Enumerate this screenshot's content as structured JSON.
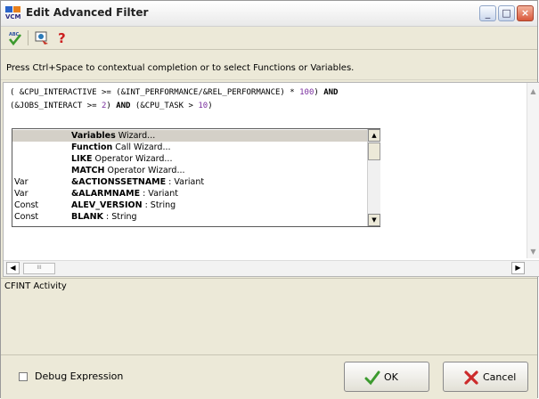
{
  "window": {
    "title": "Edit Advanced Filter",
    "app_icon_text": "VCM",
    "controls": {
      "minimize": "_",
      "maximize": "□",
      "close": "×"
    }
  },
  "toolbar": {
    "tools": [
      {
        "name": "spell-check-tool",
        "label": "ABC"
      },
      {
        "name": "expression-wizard-tool"
      },
      {
        "name": "help-tool",
        "label": "?"
      }
    ]
  },
  "hint": "Press Ctrl+Space to contextual completion or to select Functions or Variables.",
  "editor": {
    "lines": [
      [
        {
          "t": "( &CPU_INTERACTIVE >= (&INT_PERFORMANCE/&REL_PERFORMANCE) * "
        },
        {
          "t": "100",
          "c": "num"
        },
        {
          "t": ") "
        },
        {
          "t": "AND",
          "c": "kw"
        }
      ],
      [
        {
          "t": "(&JOBS_INTERACT >= "
        },
        {
          "t": "2",
          "c": "num"
        },
        {
          "t": ") "
        },
        {
          "t": "AND",
          "c": "kw"
        },
        {
          "t": " (&CPU_TASK > "
        },
        {
          "t": "10",
          "c": "num"
        },
        {
          "t": ")"
        }
      ]
    ],
    "hscroll_thumb": "III"
  },
  "completion": {
    "items": [
      {
        "category": "",
        "name": "Variables",
        "suffix": " Wizard...",
        "selected": true
      },
      {
        "category": "",
        "name": "Function",
        "suffix": " Call Wizard..."
      },
      {
        "category": "",
        "name": "LIKE",
        "suffix": " Operator Wizard..."
      },
      {
        "category": "",
        "name": "MATCH",
        "suffix": " Operator Wizard..."
      },
      {
        "category": "Var",
        "name": "&ACTIONSSETNAME",
        "suffix": " : Variant"
      },
      {
        "category": "Var",
        "name": "&ALARMNAME",
        "suffix": " : Variant"
      },
      {
        "category": "Const",
        "name": "ALEV_VERSION",
        "suffix": " : String"
      },
      {
        "category": "Const",
        "name": "BLANK",
        "suffix": " : String"
      }
    ]
  },
  "description": "CFINT Activity",
  "footer": {
    "debug_label": "Debug Expression",
    "debug_checked": false,
    "ok_label": "OK",
    "cancel_label": "Cancel"
  },
  "colors": {
    "ok_check": "#3c9a2e",
    "cancel_x": "#cc2b2b",
    "help": "#cc1f1f"
  }
}
